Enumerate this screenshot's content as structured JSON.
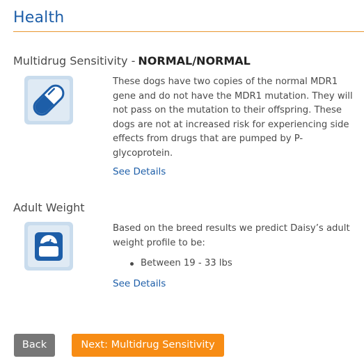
{
  "page": {
    "title": "Health"
  },
  "sections": [
    {
      "heading": "Multidrug Sensitivity -",
      "result": "NORMAL/NORMAL",
      "icon": "pill-capsule-icon",
      "description": "These dogs have two copies of the normal MDR1 gene and do not have the MDR1 mutation. They will not pass on the mutation to their offspring. These dogs are not at increased risk for experiencing side effects from drugs that are pumped by P-glycoprotein.",
      "link_label": "See Details"
    },
    {
      "heading": "Adult Weight",
      "icon": "weight-scale-icon",
      "description": "Based on the breed results we predict Daisy’s adult weight profile to be:",
      "bullets": [
        "Between 19 - 33 lbs"
      ],
      "link_label": "See Details"
    }
  ],
  "nav": {
    "back_label": "Back",
    "next_label": "Next: Multidrug Sensitivity"
  },
  "colors": {
    "title": "#1d5ea8",
    "rule": "#e8962e",
    "icon_blue": "#1d5ea8",
    "icon_bg": "#c9dced",
    "back_button": "#777777",
    "next_button": "#f78c14"
  }
}
